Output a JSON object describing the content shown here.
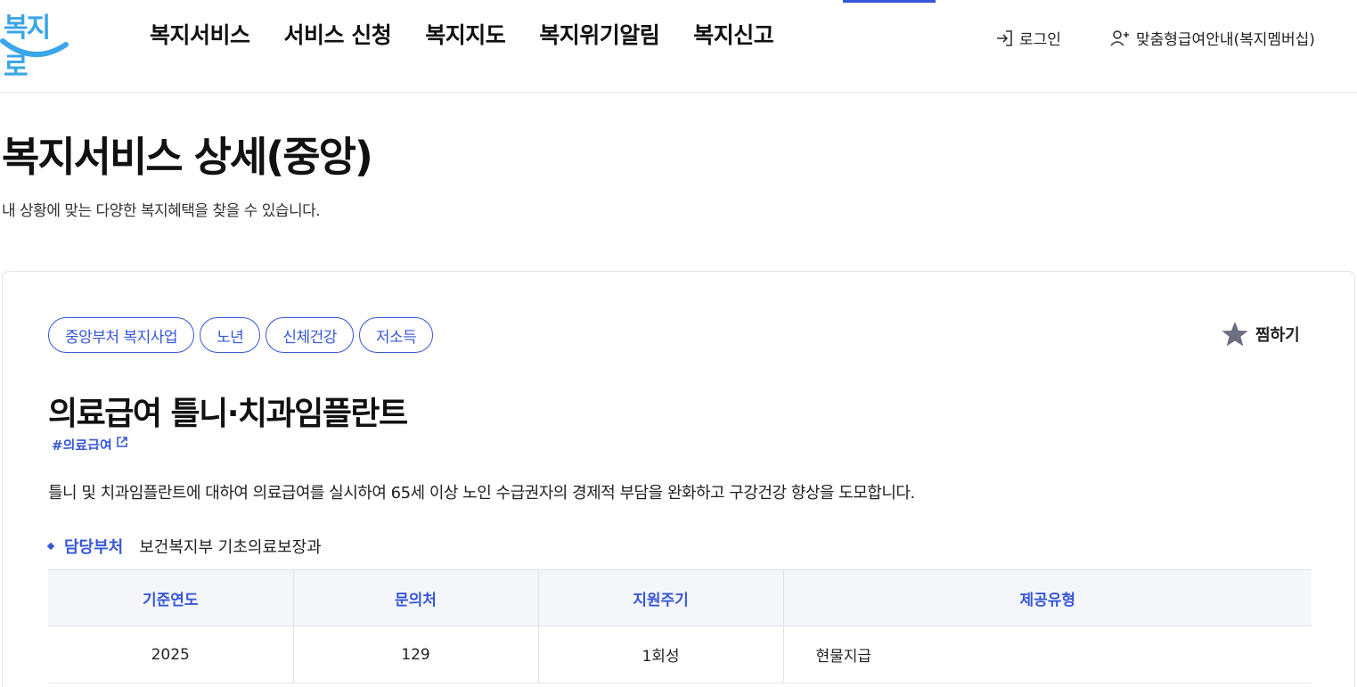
{
  "header": {
    "logo": "복지로",
    "nav": [
      "복지서비스",
      "서비스 신청",
      "복지지도",
      "복지위기알림",
      "복지신고"
    ],
    "login_label": "로그인",
    "member_label": "맞춤형급여안내(복지멤버십)",
    "accent_color": "#3657d8",
    "logo_color": "#3ba6e8"
  },
  "page": {
    "title": "복지서비스 상세(중앙)",
    "subtitle": "내 상황에 맞는 다양한 복지혜택을 찾을 수 있습니다."
  },
  "service": {
    "tags": [
      "중앙부처 복지사업",
      "노년",
      "신체건강",
      "저소득"
    ],
    "bookmark_label": "찜하기",
    "title": "의료급여 틀니·치과임플란트",
    "hashtag": "#의료급여",
    "description": "틀니 및 치과임플란트에 대하여 의료급여를 실시하여 65세 이상 노인 수급권자의 경제적 부담을 완화하고 구강건강 향상을 도모합니다.",
    "dept_label": "담당부처",
    "dept_value": "보건복지부 기초의료보장과",
    "table": {
      "headers": [
        "기준연도",
        "문의처",
        "지원주기",
        "제공유형"
      ],
      "row": [
        "2025",
        "129",
        "1회성",
        "현물지급"
      ]
    }
  }
}
